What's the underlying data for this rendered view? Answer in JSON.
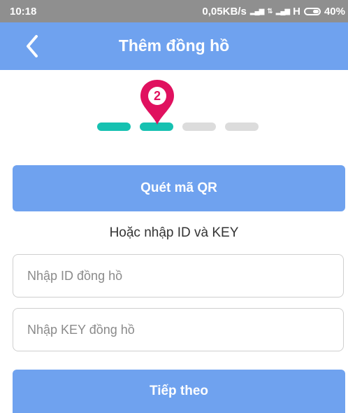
{
  "status_bar": {
    "time": "10:18",
    "network_speed": "0,05KB/s",
    "network_type": "H",
    "battery": "40%",
    "icons": [
      "signal-icon",
      "data-transfer-icon",
      "signal-icon",
      "battery-icon"
    ]
  },
  "app_bar": {
    "back_icon": "chevron-left-icon",
    "title": "Thêm đồng hồ"
  },
  "stepper": {
    "current_step": "2",
    "total_steps": 4,
    "active_color": "#16c1b1",
    "inactive_color": "#dcdcdc",
    "marker_color": "#e0115f"
  },
  "qr_button": {
    "label": "Quét mã QR"
  },
  "or_text": "Hoặc nhập ID và KEY",
  "id_field": {
    "value": "",
    "placeholder": "Nhập ID đồng hồ"
  },
  "key_field": {
    "value": "",
    "placeholder": "Nhập KEY đồng hồ"
  },
  "next_button": {
    "label": "Tiếp theo"
  },
  "colors": {
    "primary": "#6fa2ef",
    "status_bar": "#8f8f8f"
  }
}
